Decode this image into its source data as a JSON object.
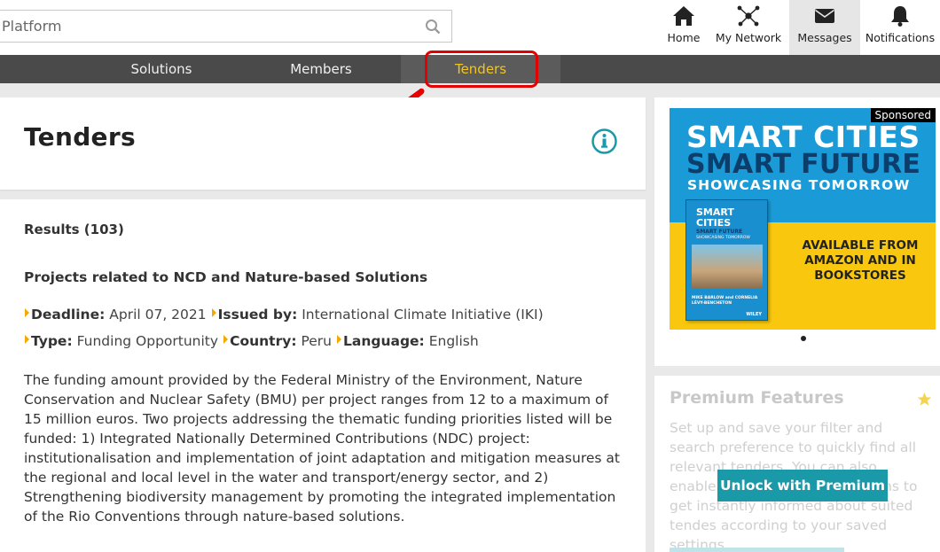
{
  "search": {
    "placeholder": "Platform"
  },
  "topnav": [
    {
      "label": "Home",
      "icon": "home-icon"
    },
    {
      "label": "My Network",
      "icon": "network-icon"
    },
    {
      "label": "Messages",
      "icon": "envelope-icon",
      "active": true
    },
    {
      "label": "Notifications",
      "icon": "bell-icon"
    }
  ],
  "subnav": {
    "solutions": "Solutions",
    "members": "Members",
    "tenders": "Tenders",
    "active_color": "#f5c518"
  },
  "page": {
    "title": "Tenders"
  },
  "results": {
    "count_label": "Results (103)",
    "item": {
      "title": "Projects related to NCD and Nature-based Solutions",
      "deadline_label": "Deadline:",
      "deadline": "April 07, 2021",
      "issued_label": "Issued by:",
      "issued_by": "International Climate Initiative (IKI)",
      "type_label": "Type:",
      "type": "Funding Opportunity",
      "country_label": "Country:",
      "country": "Peru",
      "language_label": "Language:",
      "language": "English",
      "description": "The funding amount provided by the Federal Ministry of the Environment, Nature Conservation and Nuclear Safety (BMU) per project ranges from 12 to a maximum of 15 million euros. Two projects addressing the thematic funding priorities listed will be funded: 1) Integrated Nationally Determined Contributions (NDC) project: institutionalisation and implementation of joint adaptation and mitigation measures at the regional and local level in the water and transport/energy sector, and 2) Strengthening biodiversity management by promoting the integrated implementation of the Rio Conventions through nature-based solutions."
    }
  },
  "ad": {
    "sponsored": "Sponsored",
    "line1": "SMART CITIES",
    "line2": "SMART FUTURE",
    "line3": "SHOWCASING TOMORROW",
    "book_title": "SMART CITIES",
    "book_subtitle": "SMART FUTURE",
    "book_tagline": "SHOWCASING TOMORROW",
    "book_authors": "MIKE BARLOW and CORNELIA LÉVY-BENCHETON",
    "book_publisher": "WILEY",
    "availability": "AVAILABLE FROM AMAZON AND IN BOOKSTORES"
  },
  "premium": {
    "title": "Premium Features",
    "text": "Set up and save your filter and search preference to quickly find all relevant tenders. You can also enable instant email notifications to get instantly informed about suited tendes according to your saved settings.",
    "button": "Unlock with Premium"
  }
}
